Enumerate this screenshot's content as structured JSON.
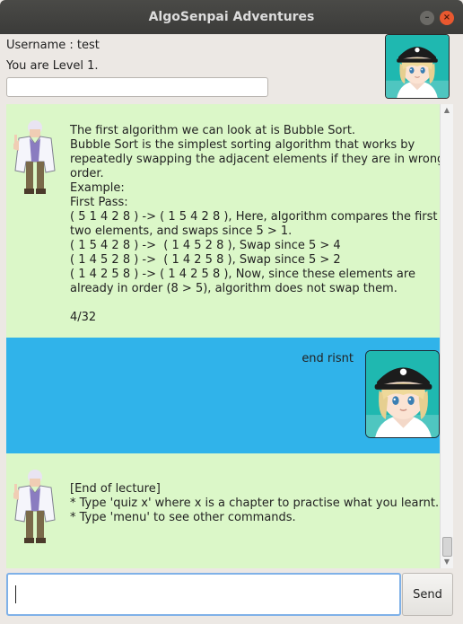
{
  "window": {
    "title": "AlgoSenpai Adventures",
    "minimize_glyph": "–",
    "close_glyph": "×"
  },
  "header": {
    "username_line": "Username : test",
    "level_line": "You are Level 1.",
    "avatar_icon": "player-avatar-icon"
  },
  "messages": [
    {
      "sender": "bot",
      "icon": "professor-sprite-icon",
      "text": "The first algorithm we can look at is Bubble Sort.\nBubble Sort is the simplest sorting algorithm that works by\nrepeatedly swapping the adjacent elements if they are in wrong\norder.\nExample:\nFirst Pass:\n( 5 1 4 2 8 ) -> ( 1 5 4 2 8 ), Here, algorithm compares the first\ntwo elements, and swaps since 5 > 1.\n( 1 5 4 2 8 ) ->  ( 1 4 5 2 8 ), Swap since 5 > 4\n( 1 4 5 2 8 ) ->  ( 1 4 2 5 8 ), Swap since 5 > 2\n( 1 4 2 5 8 ) -> ( 1 4 2 5 8 ), Now, since these elements are\nalready in order (8 > 5), algorithm does not swap them.\n\n4/32"
    },
    {
      "sender": "user",
      "icon": "player-avatar-icon",
      "text": "end risnt"
    },
    {
      "sender": "bot",
      "icon": "professor-sprite-icon",
      "text": "[End of lecture]\n* Type 'quiz x' where x is a chapter to practise what you learnt.\n* Type 'menu' to see other commands."
    }
  ],
  "input": {
    "value": "",
    "placeholder": ""
  },
  "send_button": {
    "label": "Send"
  },
  "colors": {
    "bot_bubble": "#dbf7c8",
    "user_bubble": "#30b3ea",
    "titlebar": "#3f3f3d",
    "close_button": "#e9582f"
  }
}
